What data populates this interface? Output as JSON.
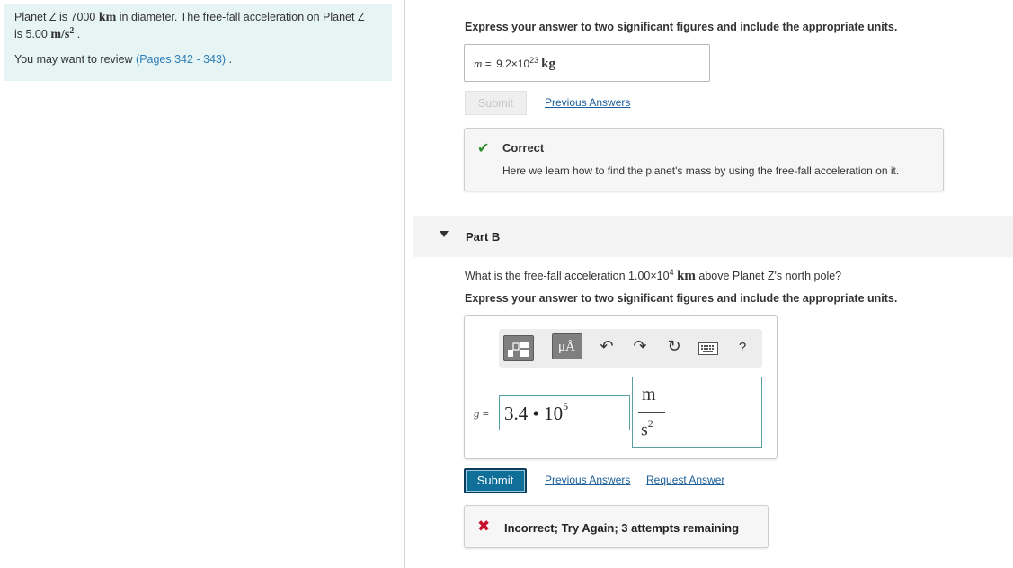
{
  "left": {
    "line1_a": "Planet Z is 7000 ",
    "line1_unit": "km",
    "line1_b": " in diameter. The free-fall acceleration on Planet Z",
    "line2_a": "is 5.00 ",
    "line2_unit": "m/s",
    "line2_exp": "2",
    "line2_b": " .",
    "review_prefix": "You may want to review ",
    "review_link": "(Pages 342 - 343)",
    "review_suffix": " ."
  },
  "partA": {
    "instruction": "Express your answer to two significant figures and include the appropriate units.",
    "answer_var": "m",
    "answer_eq": " = ",
    "answer_mantissa": "9.2×10",
    "answer_exp": "23",
    "answer_unit": "kg",
    "submit_label": "Submit",
    "previous_answers": "Previous Answers",
    "feedback_title": "Correct",
    "feedback_message": "Here we learn how to find the planet's mass by using the free-fall acceleration on it."
  },
  "partB": {
    "label": "Part B",
    "question_a": "What is the free-fall acceleration 1.00×10",
    "question_exp": "4",
    "question_unit": "km",
    "question_b": " above Planet Z's north pole?",
    "instruction": "Express your answer to two significant figures and include the appropriate units.",
    "toolbar": {
      "mu_a": "μÅ",
      "undo": "↶",
      "redo": "↷",
      "reset": "↻",
      "help": "?"
    },
    "var_label": "g",
    "var_eq": " = ",
    "value_mantissa": "3.4 • 10",
    "value_exp": "5",
    "unit_num": "m",
    "unit_den": "s",
    "unit_den_exp": "2",
    "submit_label": "Submit",
    "previous_answers": "Previous Answers",
    "request_answer": "Request Answer",
    "feedback_message": "Incorrect; Try Again; 3 attempts remaining"
  },
  "colors": {
    "left_panel_bg": "#e6f4f4",
    "link": "#1d5f9a",
    "correct_green": "#2f8f2f",
    "incorrect_red": "#c8102e",
    "submit_active": "#0f6f98"
  }
}
